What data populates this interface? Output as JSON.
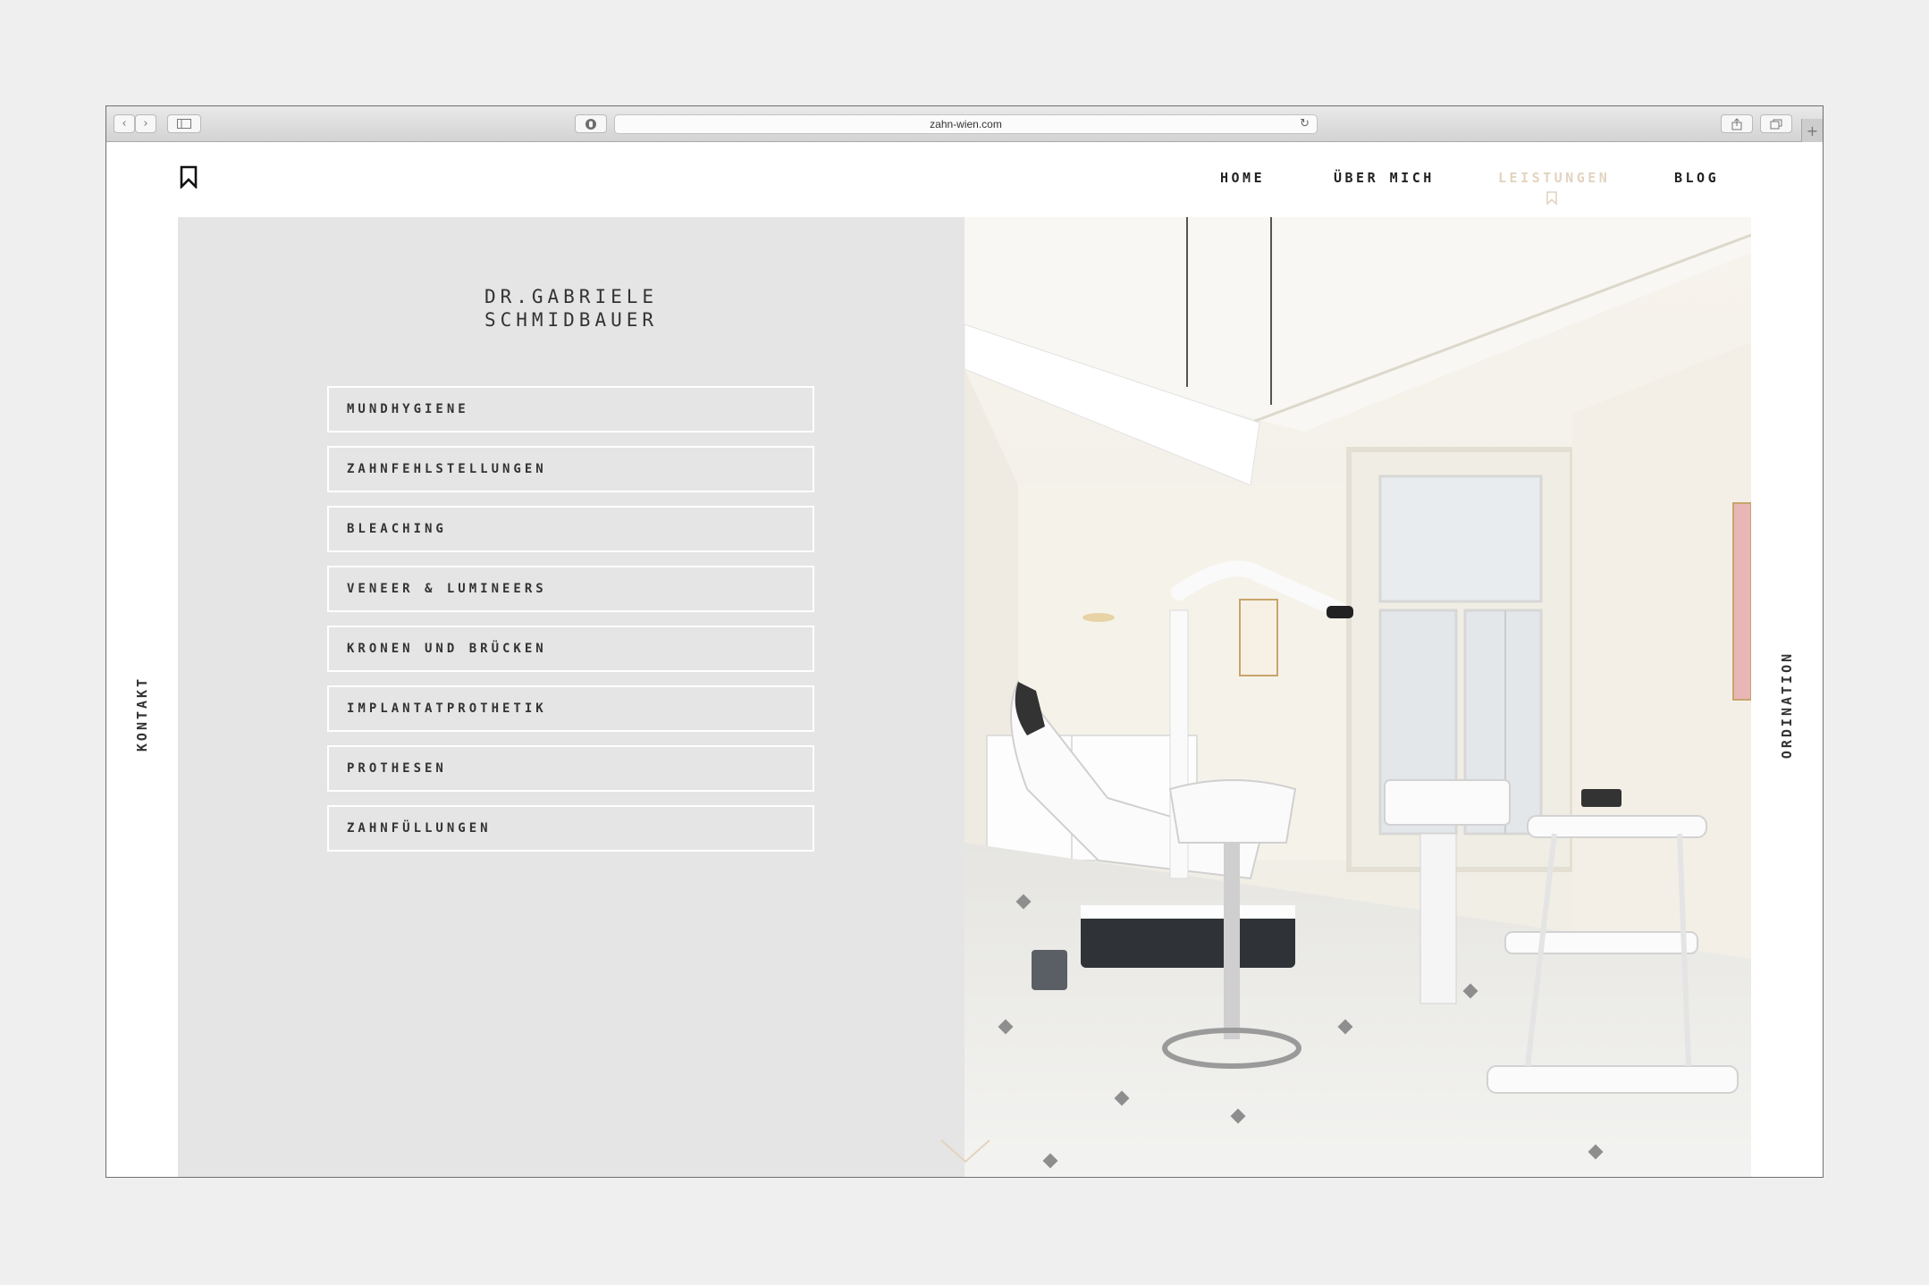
{
  "browser": {
    "url": "zahn-wien.com"
  },
  "nav": {
    "items": [
      {
        "label": "HOME"
      },
      {
        "label": "ÜBER MICH"
      },
      {
        "label": "LEISTUNGEN"
      },
      {
        "label": "BLOG"
      }
    ],
    "active_color": "#e3d3bf"
  },
  "hero": {
    "doctor_name": "DR.GABRIELE\nSCHMIDBAUER"
  },
  "services": [
    {
      "label": "MUNDHYGIENE"
    },
    {
      "label": "ZAHNFEHLSTELLUNGEN"
    },
    {
      "label": "BLEACHING"
    },
    {
      "label": "VENEER & LUMINEERS"
    },
    {
      "label": "KRONEN UND BRÜCKEN"
    },
    {
      "label": "IMPLANTATPROTHETIK"
    },
    {
      "label": "PROTHESEN"
    },
    {
      "label": "ZAHNFÜLLUNGEN"
    }
  ],
  "side_links": {
    "left": "KONTAKT",
    "right": "ORDINATION"
  },
  "colors": {
    "page_background": "#efefef",
    "panel_background": "#e5e5e5",
    "accent": "#e3d3bf",
    "text": "#333333"
  }
}
